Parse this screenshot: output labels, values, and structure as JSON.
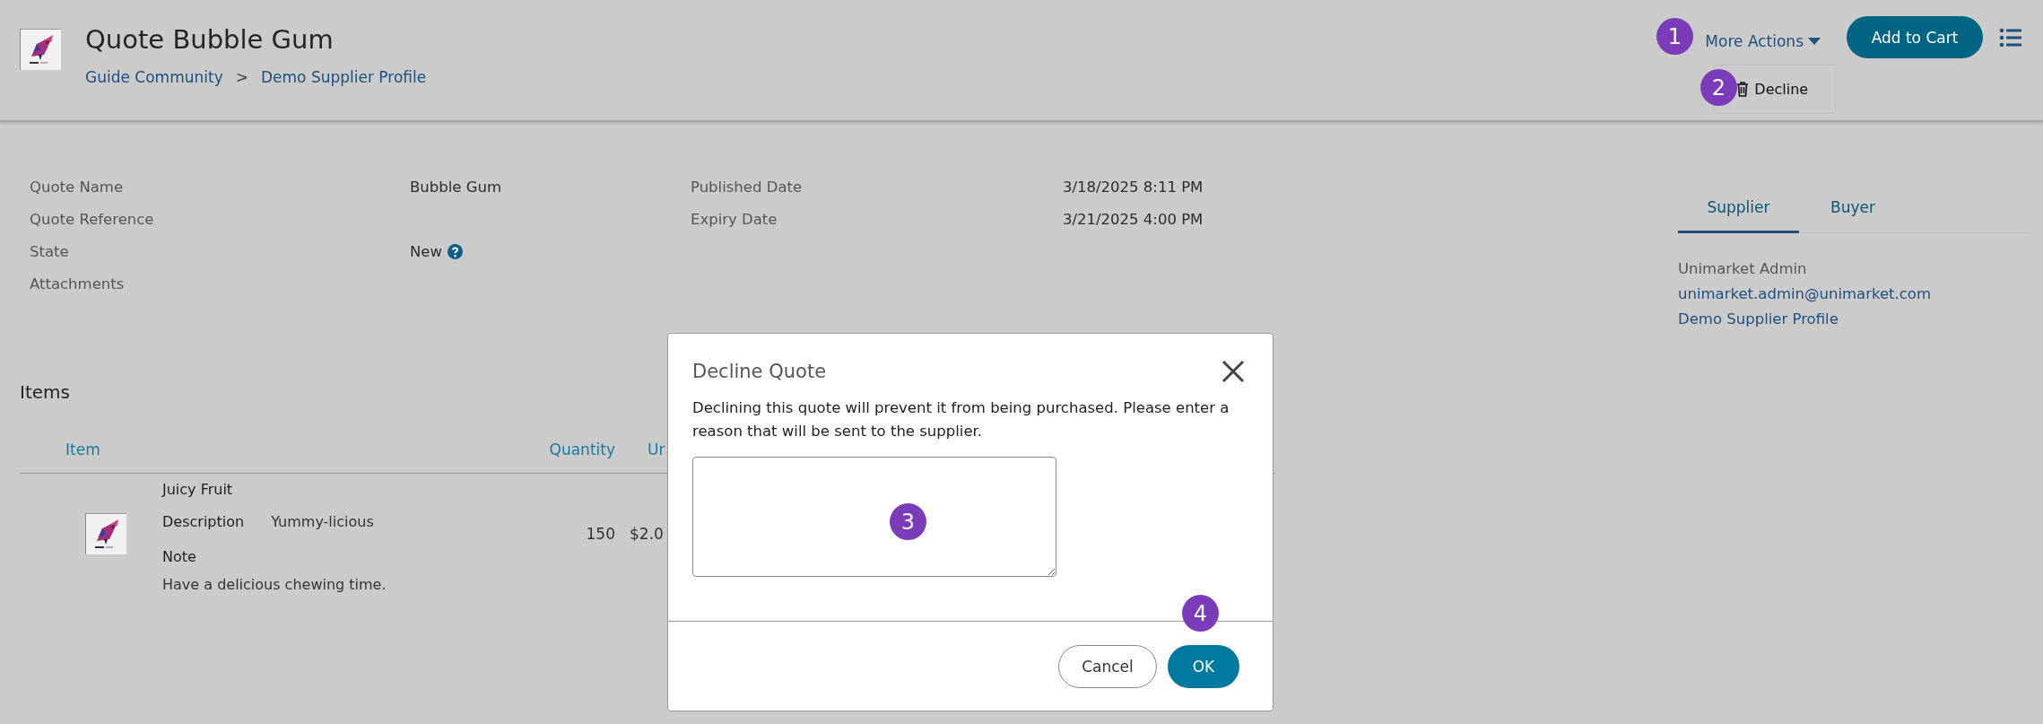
{
  "header": {
    "title": "Quote Bubble Gum",
    "breadcrumbs": [
      {
        "label": "Guide Community"
      },
      {
        "label": "Demo Supplier Profile"
      }
    ],
    "breadcrumb_separator": ">",
    "more_actions": "More Actions",
    "add_to_cart": "Add to Cart",
    "menu_items": [
      {
        "label": "Decline"
      }
    ]
  },
  "details": {
    "left": [
      {
        "label": "Quote Name",
        "value": "Bubble Gum"
      },
      {
        "label": "Quote Reference"
      },
      {
        "label": "State",
        "value": "New",
        "help": true
      },
      {
        "label": "Attachments"
      }
    ],
    "right": [
      {
        "label": "Published Date",
        "value": "3/18/2025 8:11 PM"
      },
      {
        "label": "Expiry Date",
        "value": "3/21/2025 4:00 PM"
      }
    ]
  },
  "contact": {
    "tabs": [
      {
        "label": "Supplier",
        "selected": true
      },
      {
        "label": "Buyer",
        "selected": false
      }
    ],
    "name": "Unimarket Admin",
    "email": "unimarket.admin@unimarket.com",
    "profile": "Demo Supplier Profile"
  },
  "items": {
    "heading": "Items",
    "columns": [
      "Item",
      "Quantity",
      "Ur"
    ],
    "rows": [
      {
        "name": "Juicy Fruit",
        "description_label": "Description",
        "description": "Yummy-licious",
        "note_label": "Note",
        "note": "Have a delicious chewing time.",
        "quantity": "150",
        "column_3": "$2.0"
      }
    ]
  },
  "dialog": {
    "title": "Decline Quote",
    "message": "Declining this quote will prevent it from being purchased. Please enter a reason that will be sent to the supplier.",
    "cancel": "Cancel",
    "ok": "OK"
  },
  "callouts": [
    "1",
    "2",
    "3",
    "4"
  ]
}
